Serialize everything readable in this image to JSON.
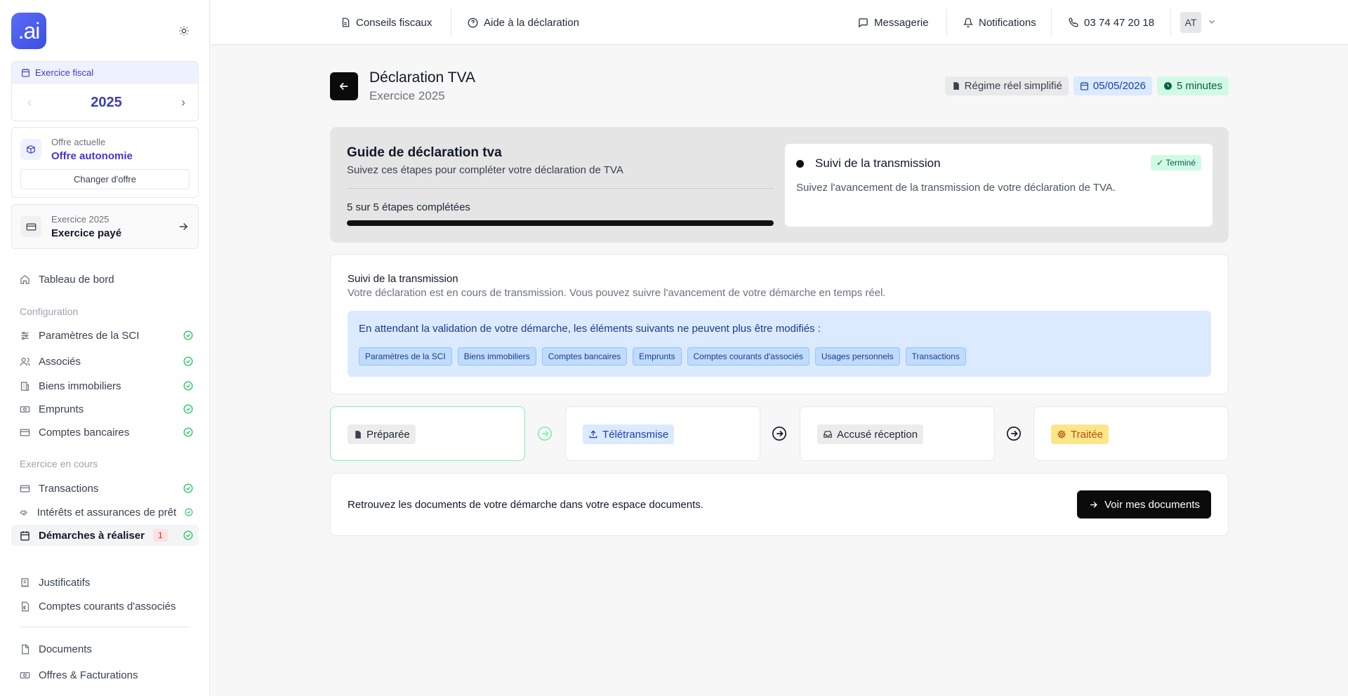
{
  "logo": {
    "text": ".ai"
  },
  "sidebar": {
    "fiscal": {
      "label": "Exercice fiscal",
      "year": "2025"
    },
    "offer": {
      "subtitle": "Offre actuelle",
      "name": "Offre autonomie",
      "change_label": "Changer d'offre"
    },
    "paid": {
      "subtitle": "Exercice 2025",
      "name": "Exercice payé"
    },
    "dashboard": "Tableau de bord",
    "section_config": "Configuration",
    "config_items": [
      {
        "label": "Paramètres de la SCI",
        "icon": "sliders-icon",
        "status": "complete"
      },
      {
        "label": "Associés",
        "icon": "users-icon",
        "status": "complete"
      },
      {
        "label": "Biens immobiliers",
        "icon": "building-icon",
        "status": "complete"
      },
      {
        "label": "Emprunts",
        "icon": "banknote-icon",
        "status": "complete"
      },
      {
        "label": "Comptes bancaires",
        "icon": "credit-card-icon",
        "status": "complete"
      }
    ],
    "section_exercise": "Exercice en cours",
    "exercise_items": [
      {
        "label": "Transactions",
        "icon": "credit-card-icon",
        "status": "complete"
      },
      {
        "label": "Intérêts et assurances de prêt",
        "icon": "handshake-icon",
        "status": "complete"
      },
      {
        "label": "Démarches à réaliser",
        "icon": "calendar-icon",
        "status": "complete",
        "badge": "1",
        "active": true
      }
    ],
    "justificatifs": "Justificatifs",
    "comptes_courants": "Comptes courants d'associés",
    "documents": "Documents",
    "offres": "Offres & Facturations"
  },
  "topbar": {
    "conseils": "Conseils fiscaux",
    "aide": "Aide à la déclaration",
    "messagerie": "Messagerie",
    "notifications": "Notifications",
    "phone": "03 74 47 20 18",
    "avatar": "AT"
  },
  "header": {
    "title": "Déclaration TVA",
    "subtitle": "Exercice 2025",
    "badges": {
      "regime": "Régime réel simplifié",
      "date": "05/05/2026",
      "duration": "5 minutes"
    }
  },
  "guide": {
    "title": "Guide de déclaration tva",
    "subtitle": "Suivez ces étapes pour compléter votre déclaration de TVA",
    "progress_text": "5 sur 5 étapes complétées",
    "progress": 1.0,
    "step": {
      "title": "Suivi de la transmission",
      "status": "✓ Terminé",
      "description": "Suivez l'avancement de la transmission de votre déclaration de TVA."
    }
  },
  "suivi": {
    "title": "Suivi de la transmission",
    "description": "Votre déclaration est en cours de transmission. Vous pouvez suivre l'avancement de votre démarche en temps réel.",
    "info": "En attendant la validation de votre démarche, les éléments suivants ne peuvent plus être modifiés :",
    "chips": [
      "Paramètres de la SCI",
      "Biens immobiliers",
      "Comptes bancaires",
      "Emprunts",
      "Comptes courants d'associés",
      "Usages personnels",
      "Transactions"
    ]
  },
  "workflow": [
    {
      "label": "Préparée",
      "icon": "file-icon",
      "state": "done"
    },
    {
      "label": "Télétransmise",
      "icon": "upload-icon",
      "state": "current"
    },
    {
      "label": "Accusé réception",
      "icon": "inbox-icon",
      "state": "pending"
    },
    {
      "label": "Traitée",
      "icon": "cog-icon",
      "state": "processing"
    }
  ],
  "docs": {
    "text": "Retrouvez les documents de votre démarche dans votre espace documents.",
    "button": "Voir mes documents"
  },
  "colors": {
    "accent": "#4338ca",
    "success": "#22c55e",
    "dark": "#0b0b0b"
  }
}
